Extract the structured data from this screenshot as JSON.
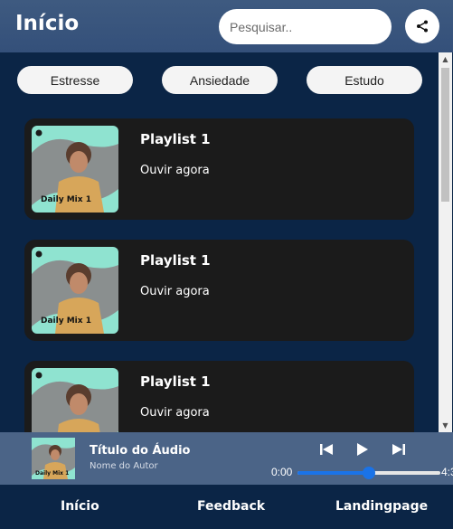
{
  "header": {
    "title": "Início",
    "search_placeholder": "Pesquisar..",
    "share_icon": "share-icon"
  },
  "chips": [
    "Estresse",
    "Ansiedade",
    "Estudo"
  ],
  "playlists": [
    {
      "title": "Playlist 1",
      "action": "Ouvir agora",
      "cover_label": "Daily Mix 1"
    },
    {
      "title": "Playlist 1",
      "action": "Ouvir agora",
      "cover_label": "Daily Mix 1"
    },
    {
      "title": "Playlist 1",
      "action": "Ouvir agora",
      "cover_label": "Daily Mix 1"
    }
  ],
  "player": {
    "audio_title": "Título do Áudio",
    "author": "Nome do Autor",
    "cover_label": "Daily Mix 1",
    "time_current": "0:00",
    "time_total": "4:3",
    "progress_fraction": 0.5,
    "icons": [
      "skip-previous-icon",
      "play-icon",
      "skip-next-icon"
    ]
  },
  "nav": {
    "items": [
      "Início",
      "Feedback",
      "Landingpage"
    ]
  },
  "colors": {
    "background": "#0b2546",
    "header": "#3e5a80",
    "card": "#1b1b1b",
    "player": "#4b6487",
    "accent": "#1a73e8",
    "cover_mint": "#8fe3d0"
  }
}
